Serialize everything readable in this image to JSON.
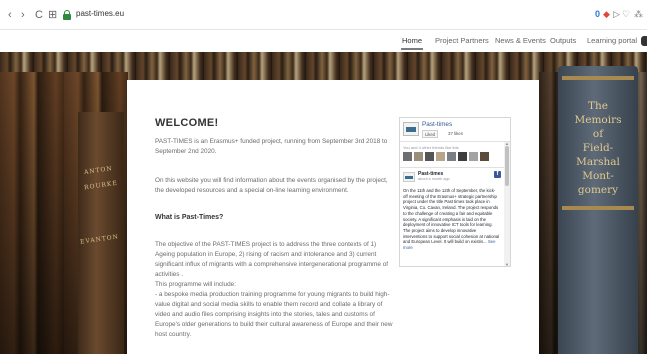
{
  "browser": {
    "back_glyph": "‹",
    "forward_glyph": "›",
    "reload_glyph": "C",
    "apps_glyph": "⊞",
    "url": "past-times.eu",
    "ext_ublock_glyph": "0",
    "ext_shield_glyph": "◆",
    "ext_cast_glyph": "▷",
    "ext_heart_glyph": "♡",
    "ext_last_glyph": "⁂",
    "ublock_color": "#2b74d8"
  },
  "nav": {
    "items": [
      "Home",
      "Project Partners",
      "News & Events",
      "Outputs",
      "Learning portal"
    ],
    "active_index": 0
  },
  "hero": {
    "book_title_lines": [
      "The",
      "Memoirs",
      "of",
      "Field-",
      "Marshal",
      "Mont-",
      "gomery"
    ],
    "spine_texts": [
      "ANTON",
      "ROURKE",
      "EVANTON"
    ]
  },
  "content": {
    "heading": "WELCOME!",
    "intro_1": "PAST-TIMES is an Erasmus+ funded project, running from September 3rd 2018 to September 2nd 2020.",
    "intro_2": "On this website you will find information about the events organised by the project, the developed resources and a special on-line learning environment.",
    "subheading": "What is Past-Times?",
    "objective": "The objective of the PAST-TIMES project is to address the three contexts of 1) Ageing population in Europe, 2) rising of racism and intolerance and 3) current significant influx of migrants with a comprehensive intergenerational programme of activities .",
    "programme_intro": "This programme will include:",
    "programme_item": "- a bespoke media production training programme for young migrants to build high-value digital and social media skills to enable them record and collate a library of video and audio files comprising insights into the stories, tales and customs of Europe's older generations to build their cultural awareness of Europe and their new host country."
  },
  "facebook": {
    "page_name": "Past-times",
    "like_label": "Liked",
    "likes_count": "37 likes",
    "friends_text": "You and 4 other friends like this",
    "face_colors": [
      "#6f6f6f",
      "#9c8f7a",
      "#555555",
      "#b9a58b",
      "#7a7f86",
      "#3e3e3e",
      "#a3a3a3",
      "#5c4a3a"
    ],
    "post_name": "Past-times",
    "post_date": "about a month ago",
    "fb_glyph": "f",
    "post_text": "On the 11th and the 12th of September, the kick-off meeting of the Erasmus+ strategic partnership project under the title Past times took place in Virginia, Co. Cavan, Ireland. The project responds to the challenge of creating a fair and equitable society. A significant emphasis is laid on the deployment of innovative ICT tools for learning. The project aims to develop innovative interventions to support social cohesion at national and European Level. It will build on existin...",
    "see_more": "See more"
  }
}
